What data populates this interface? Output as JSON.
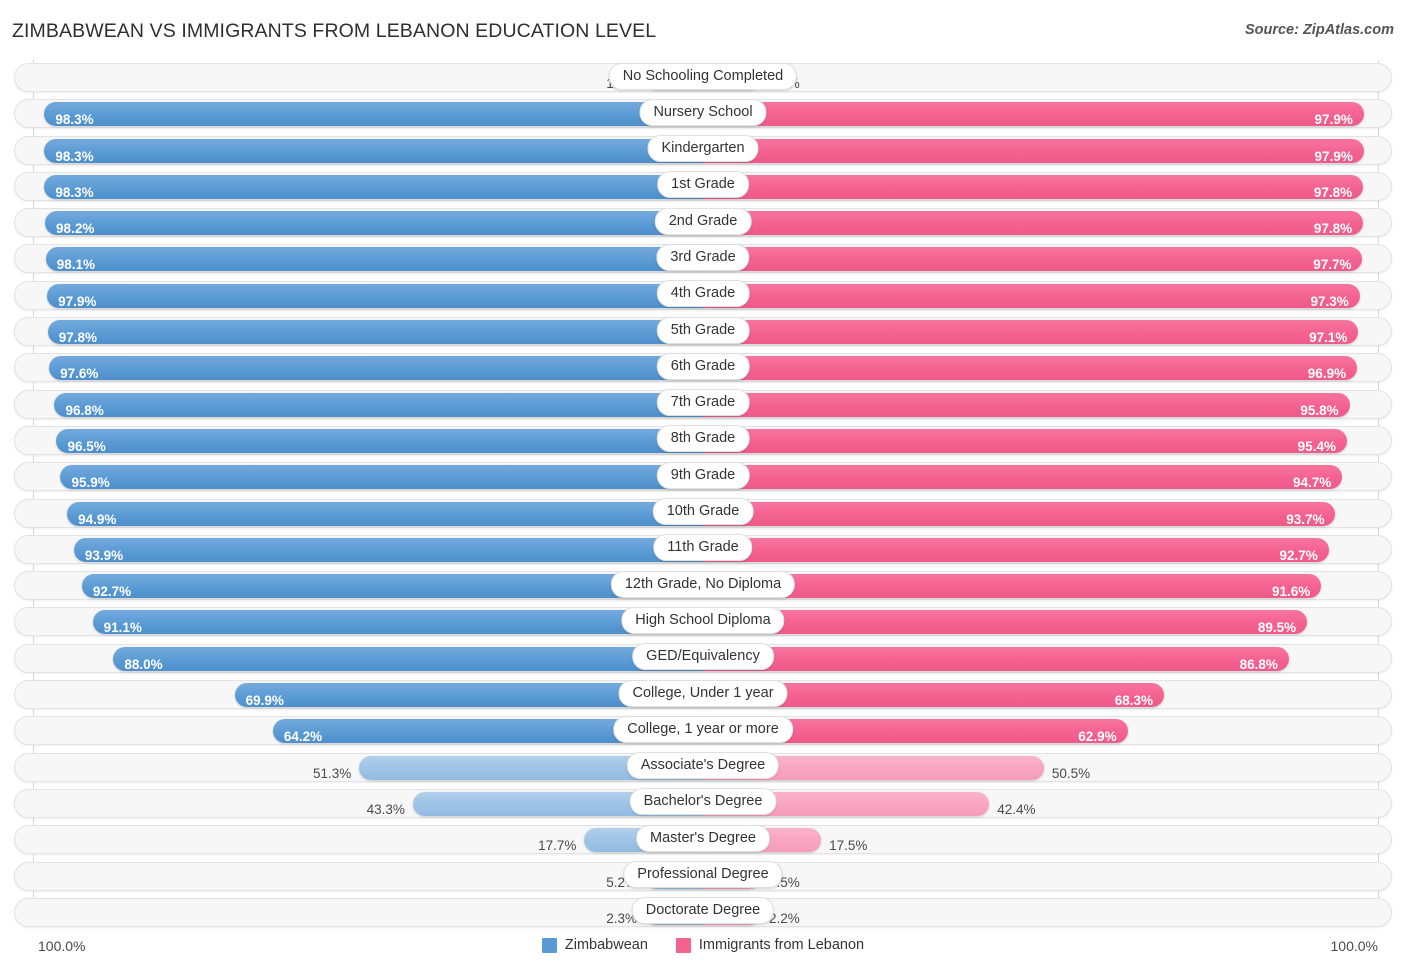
{
  "header": {
    "title": "ZIMBABWEAN VS IMMIGRANTS FROM LEBANON EDUCATION LEVEL",
    "source": "Source: ZipAtlas.com"
  },
  "footer": {
    "axis_min": "100.0%",
    "axis_max": "100.0%",
    "legend": [
      {
        "label": "Zimbabwean",
        "color": "#5b9bd5",
        "swatch": "blue"
      },
      {
        "label": "Immigrants from Lebanon",
        "color": "#f4628f",
        "swatch": "pink"
      }
    ]
  },
  "colors": {
    "left_dark": "#5b9bd5",
    "left_light": "#9dc3e6",
    "right_dark": "#f4628f",
    "right_light": "#f8a4c0",
    "track": "#f7f7f7"
  },
  "chart_data": {
    "type": "bar",
    "orientation": "horizontal-diverging",
    "title": "ZIMBABWEAN VS IMMIGRANTS FROM LEBANON EDUCATION LEVEL",
    "xlabel": "",
    "ylabel": "",
    "xlim": [
      0,
      100
    ],
    "axis_left_max_label": "100.0%",
    "axis_right_max_label": "100.0%",
    "grid": false,
    "legend_position": "bottom-center",
    "categories": [
      "No Schooling Completed",
      "Nursery School",
      "Kindergarten",
      "1st Grade",
      "2nd Grade",
      "3rd Grade",
      "4th Grade",
      "5th Grade",
      "6th Grade",
      "7th Grade",
      "8th Grade",
      "9th Grade",
      "10th Grade",
      "11th Grade",
      "12th Grade, No Diploma",
      "High School Diploma",
      "GED/Equivalency",
      "College, Under 1 year",
      "College, 1 year or more",
      "Associate's Degree",
      "Bachelor's Degree",
      "Master's Degree",
      "Professional Degree",
      "Doctorate Degree"
    ],
    "series": [
      {
        "name": "Zimbabwean",
        "color": "#5b9bd5",
        "values": [
          1.7,
          98.3,
          98.3,
          98.3,
          98.2,
          98.1,
          97.9,
          97.8,
          97.6,
          96.8,
          96.5,
          95.9,
          94.9,
          93.9,
          92.7,
          91.1,
          88.0,
          69.9,
          64.2,
          51.3,
          43.3,
          17.7,
          5.2,
          2.3
        ]
      },
      {
        "name": "Immigrants from Lebanon",
        "color": "#f4628f",
        "values": [
          2.3,
          97.9,
          97.9,
          97.8,
          97.8,
          97.7,
          97.3,
          97.1,
          96.9,
          95.8,
          95.4,
          94.7,
          93.7,
          92.7,
          91.6,
          89.5,
          86.8,
          68.3,
          62.9,
          50.5,
          42.4,
          17.5,
          5.5,
          2.2
        ]
      }
    ]
  },
  "rows": [
    {
      "label": "No Schooling Completed",
      "left": "1.7%",
      "right": "2.3%",
      "left_val": 1.7,
      "right_val": 2.3,
      "left_inside": false,
      "right_inside": false
    },
    {
      "label": "Nursery School",
      "left": "98.3%",
      "right": "97.9%",
      "left_val": 98.3,
      "right_val": 97.9,
      "left_inside": true,
      "right_inside": true
    },
    {
      "label": "Kindergarten",
      "left": "98.3%",
      "right": "97.9%",
      "left_val": 98.3,
      "right_val": 97.9,
      "left_inside": true,
      "right_inside": true
    },
    {
      "label": "1st Grade",
      "left": "98.3%",
      "right": "97.8%",
      "left_val": 98.3,
      "right_val": 97.8,
      "left_inside": true,
      "right_inside": true
    },
    {
      "label": "2nd Grade",
      "left": "98.2%",
      "right": "97.8%",
      "left_val": 98.2,
      "right_val": 97.8,
      "left_inside": true,
      "right_inside": true
    },
    {
      "label": "3rd Grade",
      "left": "98.1%",
      "right": "97.7%",
      "left_val": 98.1,
      "right_val": 97.7,
      "left_inside": true,
      "right_inside": true
    },
    {
      "label": "4th Grade",
      "left": "97.9%",
      "right": "97.3%",
      "left_val": 97.9,
      "right_val": 97.3,
      "left_inside": true,
      "right_inside": true
    },
    {
      "label": "5th Grade",
      "left": "97.8%",
      "right": "97.1%",
      "left_val": 97.8,
      "right_val": 97.1,
      "left_inside": true,
      "right_inside": true
    },
    {
      "label": "6th Grade",
      "left": "97.6%",
      "right": "96.9%",
      "left_val": 97.6,
      "right_val": 96.9,
      "left_inside": true,
      "right_inside": true
    },
    {
      "label": "7th Grade",
      "left": "96.8%",
      "right": "95.8%",
      "left_val": 96.8,
      "right_val": 95.8,
      "left_inside": true,
      "right_inside": true
    },
    {
      "label": "8th Grade",
      "left": "96.5%",
      "right": "95.4%",
      "left_val": 96.5,
      "right_val": 95.4,
      "left_inside": true,
      "right_inside": true
    },
    {
      "label": "9th Grade",
      "left": "95.9%",
      "right": "94.7%",
      "left_val": 95.9,
      "right_val": 94.7,
      "left_inside": true,
      "right_inside": true
    },
    {
      "label": "10th Grade",
      "left": "94.9%",
      "right": "93.7%",
      "left_val": 94.9,
      "right_val": 93.7,
      "left_inside": true,
      "right_inside": true
    },
    {
      "label": "11th Grade",
      "left": "93.9%",
      "right": "92.7%",
      "left_val": 93.9,
      "right_val": 92.7,
      "left_inside": true,
      "right_inside": true
    },
    {
      "label": "12th Grade, No Diploma",
      "left": "92.7%",
      "right": "91.6%",
      "left_val": 92.7,
      "right_val": 91.6,
      "left_inside": true,
      "right_inside": true
    },
    {
      "label": "High School Diploma",
      "left": "91.1%",
      "right": "89.5%",
      "left_val": 91.1,
      "right_val": 89.5,
      "left_inside": true,
      "right_inside": true
    },
    {
      "label": "GED/Equivalency",
      "left": "88.0%",
      "right": "86.8%",
      "left_val": 88.0,
      "right_val": 86.8,
      "left_inside": true,
      "right_inside": true
    },
    {
      "label": "College, Under 1 year",
      "left": "69.9%",
      "right": "68.3%",
      "left_val": 69.9,
      "right_val": 68.3,
      "left_inside": true,
      "right_inside": true
    },
    {
      "label": "College, 1 year or more",
      "left": "64.2%",
      "right": "62.9%",
      "left_val": 64.2,
      "right_val": 62.9,
      "left_inside": true,
      "right_inside": true
    },
    {
      "label": "Associate's Degree",
      "left": "51.3%",
      "right": "50.5%",
      "left_val": 51.3,
      "right_val": 50.5,
      "left_inside": false,
      "right_inside": false
    },
    {
      "label": "Bachelor's Degree",
      "left": "43.3%",
      "right": "42.4%",
      "left_val": 43.3,
      "right_val": 42.4,
      "left_inside": false,
      "right_inside": false
    },
    {
      "label": "Master's Degree",
      "left": "17.7%",
      "right": "17.5%",
      "left_val": 17.7,
      "right_val": 17.5,
      "left_inside": false,
      "right_inside": false
    },
    {
      "label": "Professional Degree",
      "left": "5.2%",
      "right": "5.5%",
      "left_val": 5.2,
      "right_val": 5.5,
      "left_inside": false,
      "right_inside": false
    },
    {
      "label": "Doctorate Degree",
      "left": "2.3%",
      "right": "2.2%",
      "left_val": 2.3,
      "right_val": 2.2,
      "left_inside": false,
      "right_inside": false
    }
  ]
}
